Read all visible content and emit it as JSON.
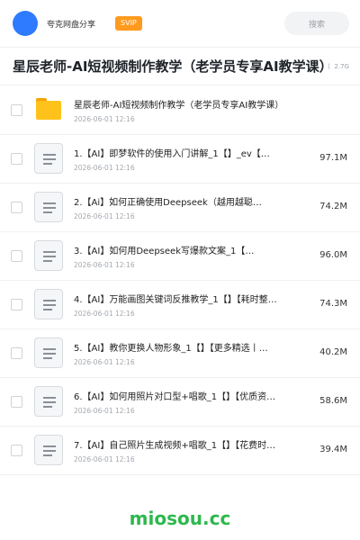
{
  "header": {
    "share_name": "夸克网盘分享",
    "badge": "SVIP",
    "search_placeholder": "搜索"
  },
  "folder_title": "星辰老师-AI短视频制作教学（老学员专享AI教学课）",
  "meta": "丨 2.7G",
  "items": [
    {
      "type": "folder",
      "name": "星辰老师-AI短视频制作教学（老学员专享AI教学课）",
      "date": "2026-06-01 12:16",
      "size": ""
    },
    {
      "type": "file",
      "name": "1.【AI】即梦软件的使用入门讲解_1【】_ev【…",
      "date": "2026-06-01 12:16",
      "size": "97.1M"
    },
    {
      "type": "file",
      "name": "2.【Ai】如何正确使用Deepseek（越用越聪…",
      "date": "2026-06-01 12:16",
      "size": "74.2M"
    },
    {
      "type": "file",
      "name": "3.【AI】如何用Deepseek写爆款文案_1【…",
      "date": "2026-06-01 12:16",
      "size": "96.0M"
    },
    {
      "type": "file",
      "name": "4.【AI】万能画图关键词反推教学_1【】【耗时整…",
      "date": "2026-06-01 12:16",
      "size": "74.3M"
    },
    {
      "type": "file",
      "name": "5.【AI】教你更换人物形象_1【】【更多精选丨…",
      "date": "2026-06-01 12:16",
      "size": "40.2M"
    },
    {
      "type": "file",
      "name": "6.【AI】如何用照片对口型+唱歌_1【】【优质资…",
      "date": "2026-06-01 12:16",
      "size": "58.6M"
    },
    {
      "type": "file",
      "name": "7.【AI】自己照片生成视频+唱歌_1【】【花费时…",
      "date": "2026-06-01 12:16",
      "size": "39.4M"
    }
  ],
  "watermark": "miosou.cc",
  "colors": {
    "avatar": "#2f7bff",
    "badge": "#ff9a1e",
    "folder": "#ffc21a",
    "watermark": "#2db84d"
  }
}
